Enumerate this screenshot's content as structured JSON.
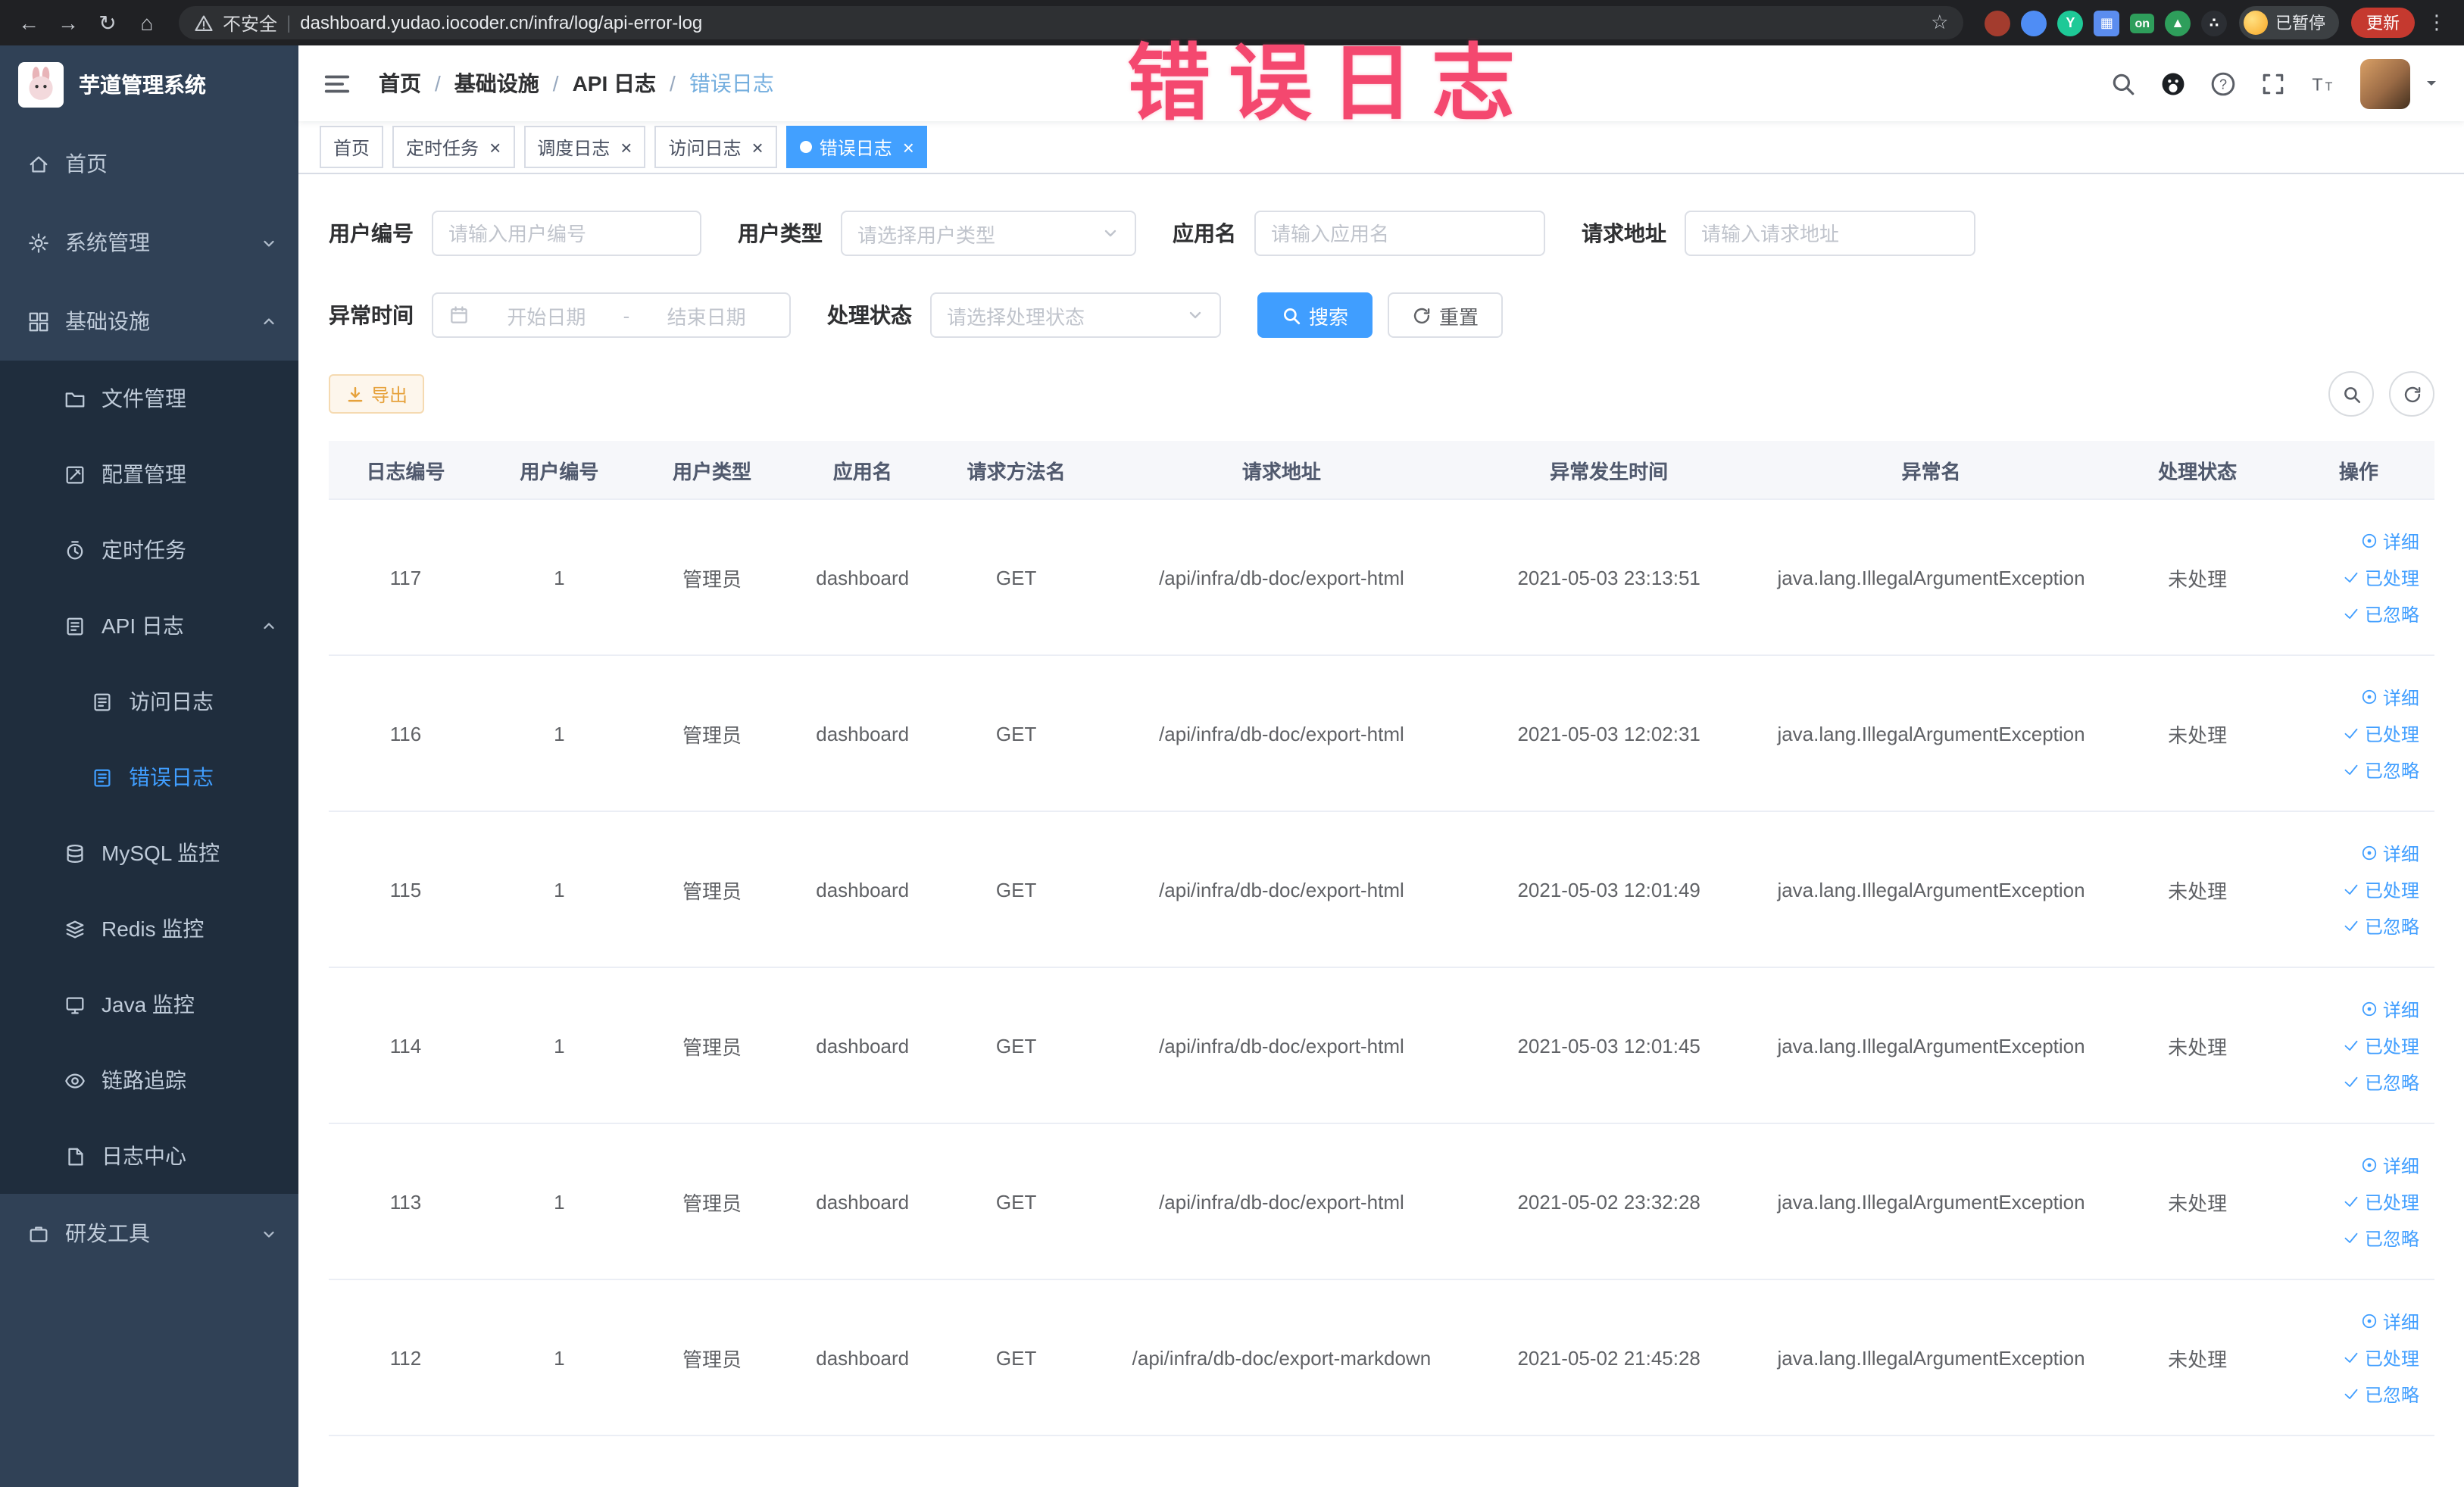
{
  "annotation": {
    "text": "错误日志"
  },
  "browser": {
    "security_label": "不安全",
    "url": "dashboard.yudao.iocoder.cn/infra/log/api-error-log",
    "on_badge": "on",
    "paused_label": "已暂停",
    "update_label": "更新"
  },
  "icon_glyphs": {
    "back": "←",
    "forward": "→",
    "reload": "↻",
    "home": "⌂",
    "star": "☆",
    "more": "⋮",
    "close": "×",
    "check": "✓"
  },
  "sidebar": {
    "logo_title": "芋道管理系统",
    "menu": [
      {
        "key": "home",
        "label": "首页",
        "icon": "home-icon",
        "level": 1
      },
      {
        "key": "system-management",
        "label": "系统管理",
        "icon": "gear-icon",
        "level": 1,
        "chevron": "down"
      },
      {
        "key": "infrastructure",
        "label": "基础设施",
        "icon": "grid-icon",
        "level": 1,
        "chevron": "up"
      },
      {
        "key": "file-management",
        "label": "文件管理",
        "icon": "folder-icon",
        "level": 2
      },
      {
        "key": "config-management",
        "label": "配置管理",
        "icon": "config-icon",
        "level": 2
      },
      {
        "key": "scheduled-jobs",
        "label": "定时任务",
        "icon": "timer-icon",
        "level": 2
      },
      {
        "key": "api-log",
        "label": "API 日志",
        "icon": "api-log-icon",
        "level": 2,
        "chevron": "up"
      },
      {
        "key": "access-log",
        "label": "访问日志",
        "icon": "doc-icon",
        "level": 3
      },
      {
        "key": "error-log",
        "label": "错误日志",
        "icon": "doc-icon",
        "level": 3,
        "active": true
      },
      {
        "key": "mysql-monitor",
        "label": "MySQL 监控",
        "icon": "mysql-icon",
        "level": 2
      },
      {
        "key": "redis-monitor",
        "label": "Redis 监控",
        "icon": "redis-icon",
        "level": 2
      },
      {
        "key": "java-monitor",
        "label": "Java 监控",
        "icon": "java-icon",
        "level": 2
      },
      {
        "key": "tracing",
        "label": "链路追踪",
        "icon": "trace-icon",
        "level": 2
      },
      {
        "key": "log-center",
        "label": "日志中心",
        "icon": "log-center-icon",
        "level": 2
      },
      {
        "key": "dev-tools",
        "label": "研发工具",
        "icon": "tools-icon",
        "level": 1,
        "chevron": "down"
      }
    ]
  },
  "breadcrumb": [
    "首页",
    "基础设施",
    "API 日志",
    "错误日志"
  ],
  "tags": [
    {
      "key": "home",
      "label": "首页",
      "closable": false,
      "active": false
    },
    {
      "key": "scheduled-jobs",
      "label": "定时任务",
      "closable": true,
      "active": false
    },
    {
      "key": "schedule-log",
      "label": "调度日志",
      "closable": true,
      "active": false
    },
    {
      "key": "access-log",
      "label": "访问日志",
      "closable": true,
      "active": false
    },
    {
      "key": "error-log",
      "label": "错误日志",
      "closable": true,
      "active": true
    }
  ],
  "filters": {
    "user_id": {
      "label": "用户编号",
      "placeholder": "请输入用户编号"
    },
    "user_type": {
      "label": "用户类型",
      "placeholder": "请选择用户类型"
    },
    "app_name": {
      "label": "应用名",
      "placeholder": "请输入应用名"
    },
    "request_url": {
      "label": "请求地址",
      "placeholder": "请输入请求地址"
    },
    "exception_time": {
      "label": "异常时间",
      "start_placeholder": "开始日期",
      "separator": "-",
      "end_placeholder": "结束日期"
    },
    "process_status": {
      "label": "处理状态",
      "placeholder": "请选择处理状态"
    },
    "search_label": "搜索",
    "reset_label": "重置"
  },
  "toolbar": {
    "export_label": "导出"
  },
  "table": {
    "headers": [
      "日志编号",
      "用户编号",
      "用户类型",
      "应用名",
      "请求方法名",
      "请求地址",
      "异常发生时间",
      "异常名",
      "处理状态",
      "操作"
    ],
    "action_labels": {
      "detail": "详细",
      "processed": "已处理",
      "ignored": "已忽略"
    },
    "rows": [
      {
        "id": "117",
        "user_id": "1",
        "user_type": "管理员",
        "app": "dashboard",
        "method": "GET",
        "url": "/api/infra/db-doc/export-html",
        "time": "2021-05-03 23:13:51",
        "exception": "java.lang.IllegalArgumentException",
        "status": "未处理"
      },
      {
        "id": "116",
        "user_id": "1",
        "user_type": "管理员",
        "app": "dashboard",
        "method": "GET",
        "url": "/api/infra/db-doc/export-html",
        "time": "2021-05-03 12:02:31",
        "exception": "java.lang.IllegalArgumentException",
        "status": "未处理"
      },
      {
        "id": "115",
        "user_id": "1",
        "user_type": "管理员",
        "app": "dashboard",
        "method": "GET",
        "url": "/api/infra/db-doc/export-html",
        "time": "2021-05-03 12:01:49",
        "exception": "java.lang.IllegalArgumentException",
        "status": "未处理"
      },
      {
        "id": "114",
        "user_id": "1",
        "user_type": "管理员",
        "app": "dashboard",
        "method": "GET",
        "url": "/api/infra/db-doc/export-html",
        "time": "2021-05-03 12:01:45",
        "exception": "java.lang.IllegalArgumentException",
        "status": "未处理"
      },
      {
        "id": "113",
        "user_id": "1",
        "user_type": "管理员",
        "app": "dashboard",
        "method": "GET",
        "url": "/api/infra/db-doc/export-html",
        "time": "2021-05-02 23:32:28",
        "exception": "java.lang.IllegalArgumentException",
        "status": "未处理"
      },
      {
        "id": "112",
        "user_id": "1",
        "user_type": "管理员",
        "app": "dashboard",
        "method": "GET",
        "url": "/api/infra/db-doc/export-markdown",
        "time": "2021-05-02 21:45:28",
        "exception": "java.lang.IllegalArgumentException",
        "status": "未处理"
      }
    ]
  },
  "colors": {
    "primary": "#409EFF",
    "warning": "#e6a23c",
    "sidebar_bg": "#304156",
    "submenu_bg": "#1f2d3d",
    "annotation": "#f4486f"
  }
}
